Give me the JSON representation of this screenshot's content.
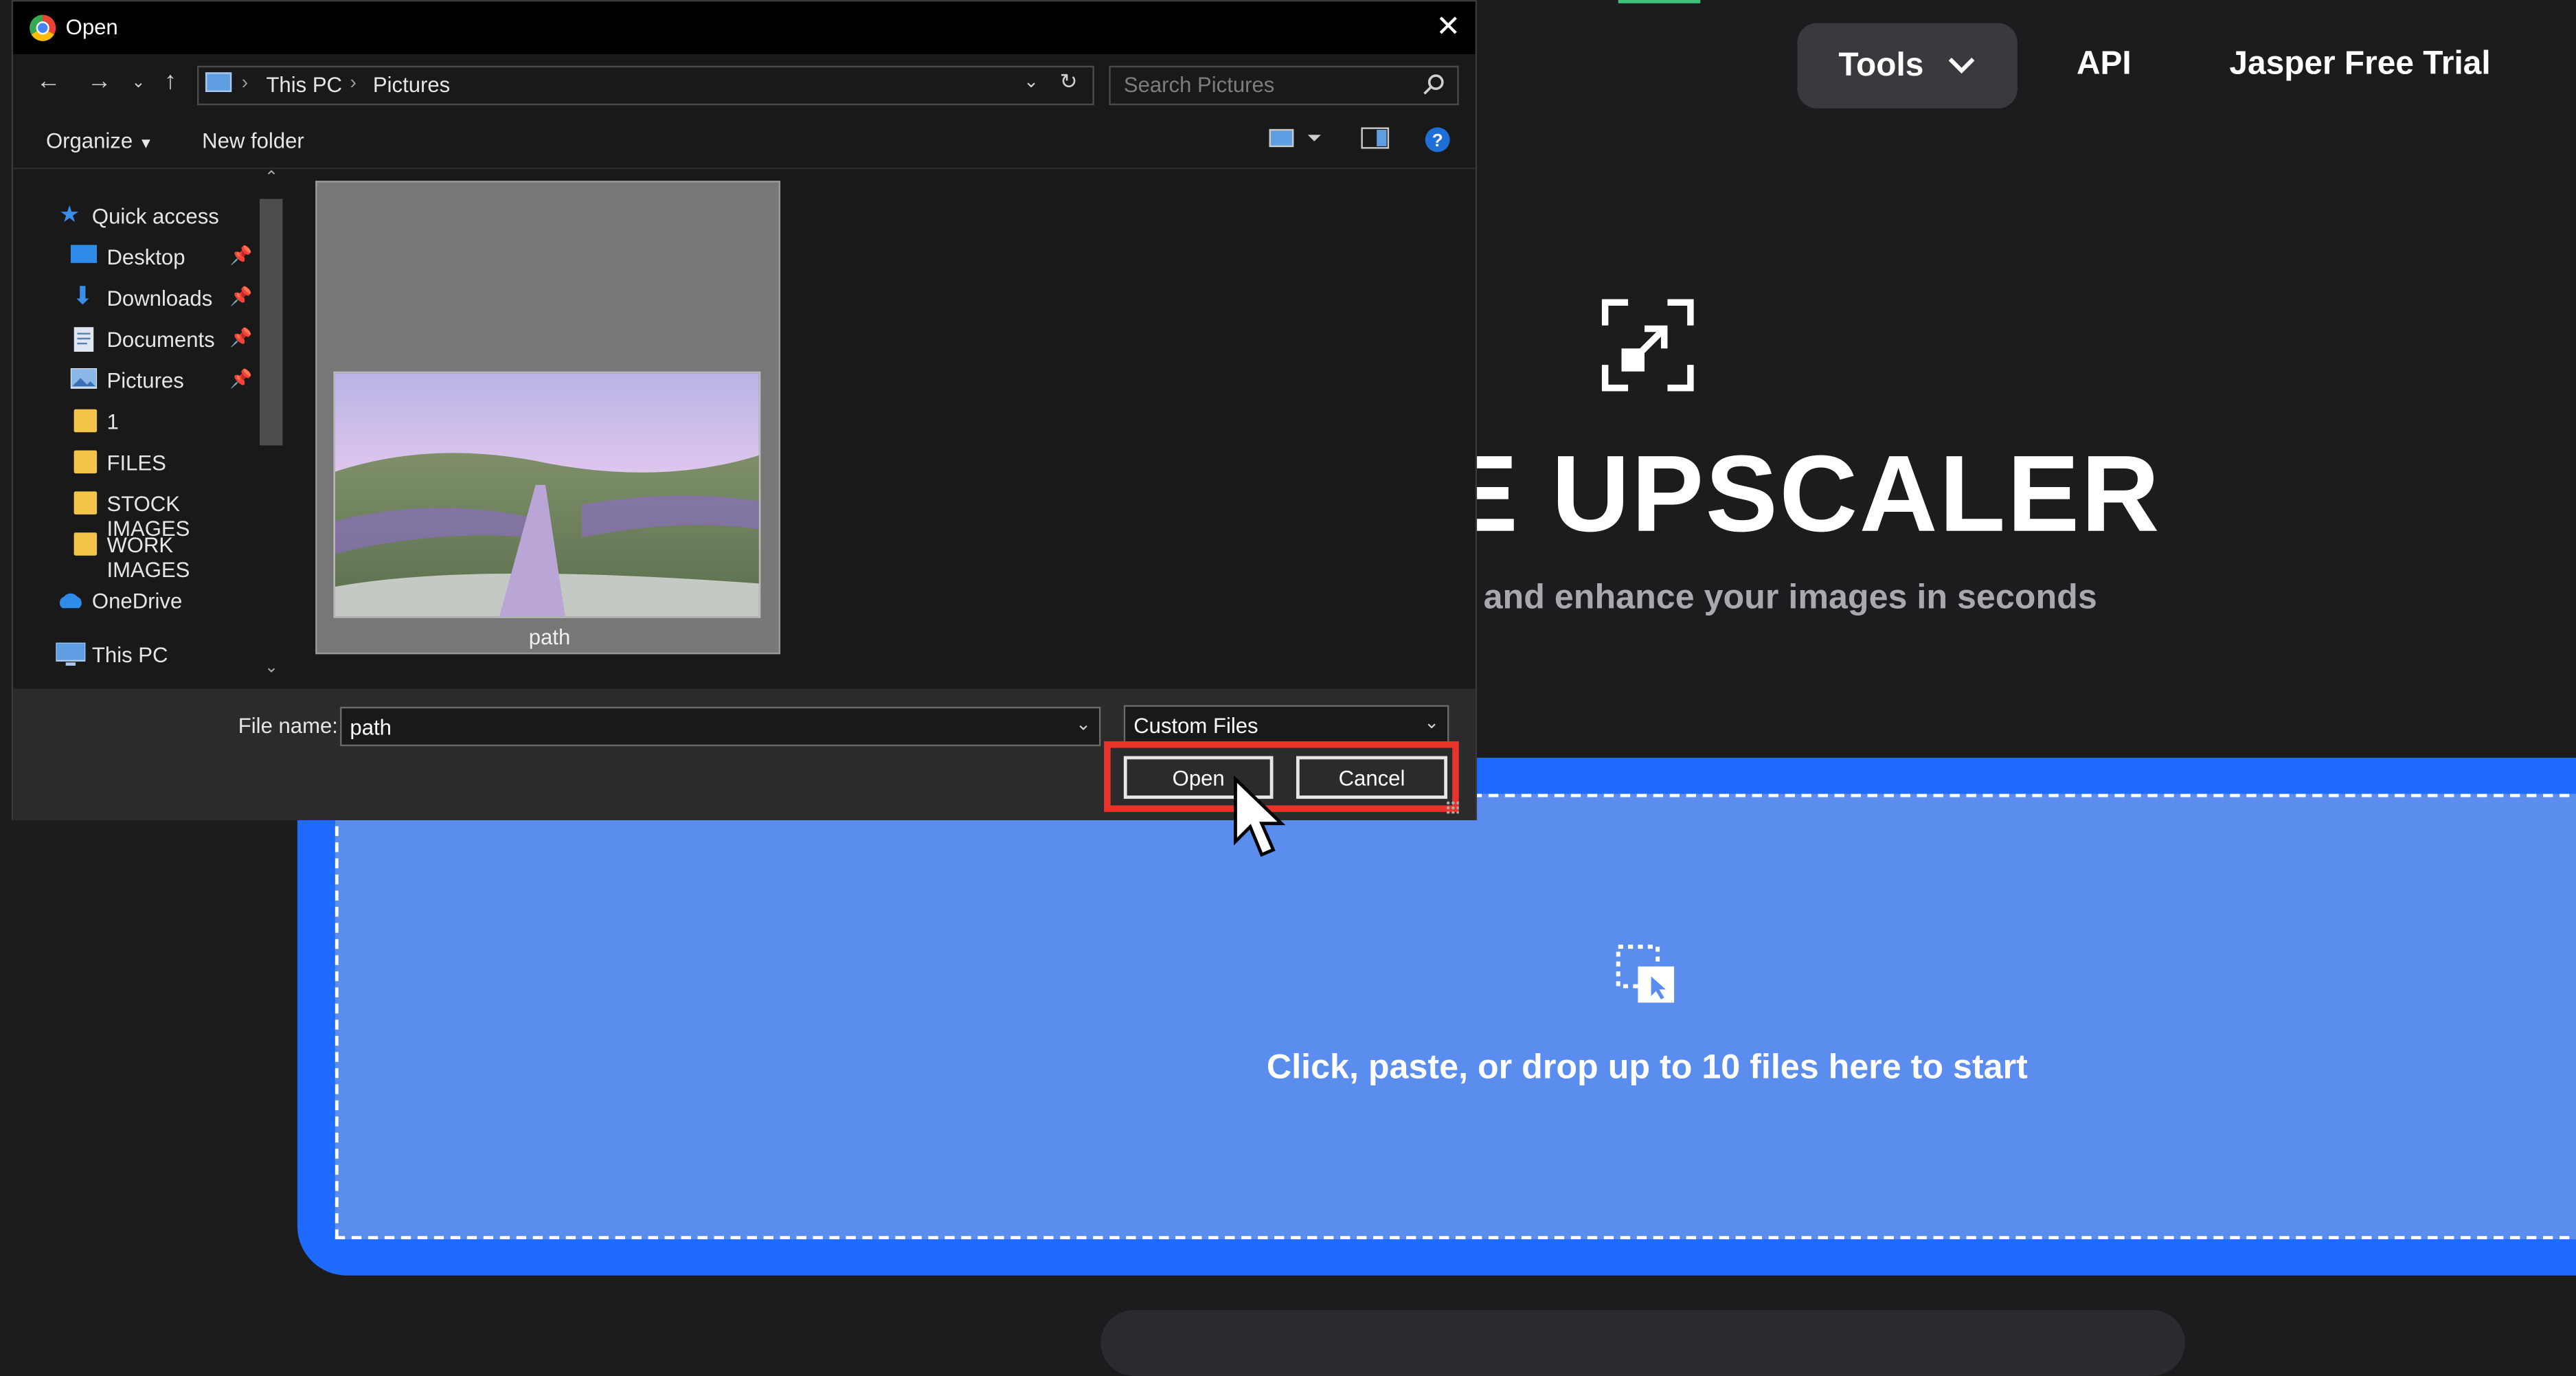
{
  "webpage": {
    "nav": {
      "tools_label": "Tools",
      "api_label": "API",
      "trial_label": "Jasper Free Trial"
    },
    "hero": {
      "title_visible": "E UPSCALER",
      "subtitle_visible": "and enhance your images in seconds"
    },
    "dropzone": {
      "text": "Click, paste, or drop up to 10 files here to start"
    },
    "colors": {
      "background": "#1c1c1e",
      "dropzone": "#1f6bff",
      "dropzone_inner": "#5b8def"
    }
  },
  "dialog": {
    "title": "Open",
    "breadcrumb": [
      "This PC",
      "Pictures"
    ],
    "search_placeholder": "Search Pictures",
    "commands": {
      "organize": "Organize",
      "new_folder": "New folder"
    },
    "nav_items": [
      {
        "label": "Quick access",
        "icon": "star-icon"
      },
      {
        "label": "Desktop",
        "icon": "desktop-icon",
        "pinned": true
      },
      {
        "label": "Downloads",
        "icon": "download-icon",
        "pinned": true
      },
      {
        "label": "Documents",
        "icon": "document-icon",
        "pinned": true
      },
      {
        "label": "Pictures",
        "icon": "pictures-icon",
        "pinned": true
      },
      {
        "label": "1",
        "icon": "folder-icon"
      },
      {
        "label": "FILES",
        "icon": "folder-icon"
      },
      {
        "label": "STOCK IMAGES",
        "icon": "folder-icon"
      },
      {
        "label": "WORK IMAGES",
        "icon": "folder-icon"
      },
      {
        "label": "OneDrive",
        "icon": "cloud-icon"
      },
      {
        "label": "This PC",
        "icon": "computer-icon"
      }
    ],
    "files": [
      {
        "name": "path",
        "selected": true
      }
    ],
    "file_name_label": "File name:",
    "file_name_value": "path",
    "file_type": "Custom Files",
    "open_label": "Open",
    "cancel_label": "Cancel",
    "highlight_color": "#e8332a"
  }
}
